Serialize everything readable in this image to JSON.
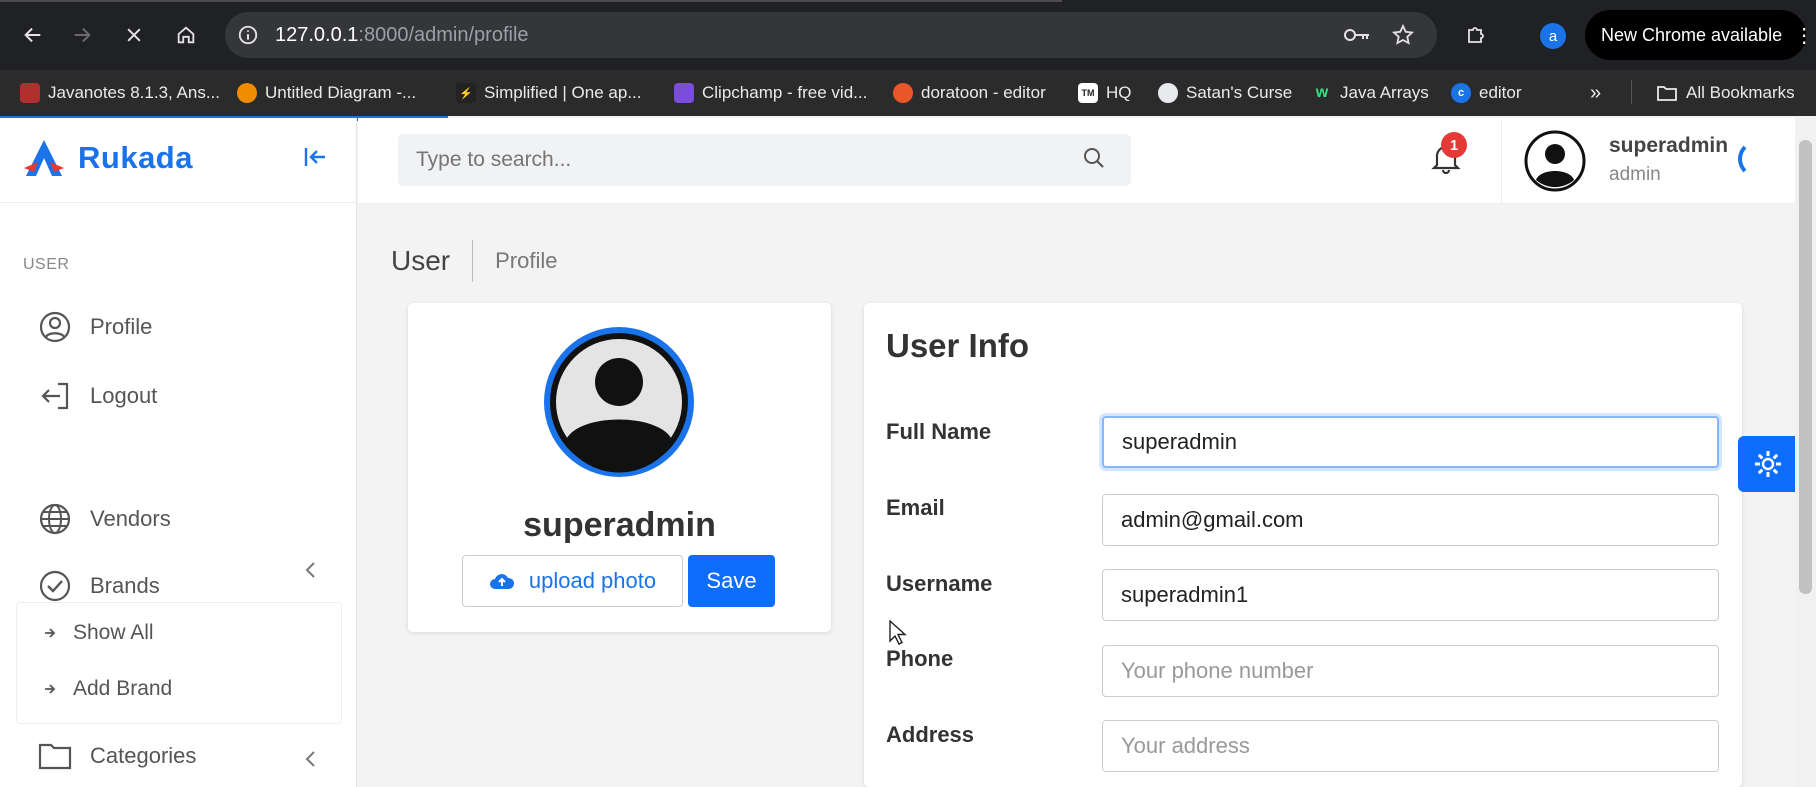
{
  "browser": {
    "url_host": "127.0.0.1",
    "url_rest": ":8000/admin/profile",
    "update_label": "New Chrome available",
    "profile_initial": "a",
    "bookmarks": [
      {
        "label": "Javanotes 8.1.3, Ans...",
        "color": "#b03030"
      },
      {
        "label": "Untitled Diagram -...",
        "color": "#f08c00"
      },
      {
        "label": "Simplified | One ap...",
        "color": "#222222"
      },
      {
        "label": "Clipchamp - free vid...",
        "color": "#7b4ddb"
      },
      {
        "label": "doratoon - editor",
        "color": "#e8562a"
      },
      {
        "label": "HQ",
        "color": "#444444"
      },
      {
        "label": "Satan's Curse",
        "color": "#5f6368"
      },
      {
        "label": "Java Arrays",
        "color": "#2e7d32"
      },
      {
        "label": "editor",
        "color": "#1a73e8"
      }
    ],
    "all_bookmarks": "All Bookmarks"
  },
  "app": {
    "brand": "Rukada",
    "accent": "#1a73e8",
    "search_placeholder": "Type to search...",
    "notifications": "1",
    "user_name": "superadmin",
    "user_role": "admin"
  },
  "sidebar": {
    "section": "USER",
    "items": [
      {
        "label": "Profile",
        "icon": "user-circle-icon"
      },
      {
        "label": "Logout",
        "icon": "logout-icon"
      },
      {
        "label": "Vendors",
        "icon": "globe-icon"
      },
      {
        "label": "Brands",
        "icon": "check-circle-icon"
      },
      {
        "label": "Categories",
        "icon": "folder-icon"
      }
    ],
    "brand_sub": [
      "Show All",
      "Add Brand"
    ]
  },
  "breadcrumb": {
    "root": "User",
    "current": "Profile"
  },
  "profile_card": {
    "name": "superadmin",
    "upload_label": "upload photo",
    "save_label": "Save"
  },
  "user_info": {
    "title": "User Info",
    "fields": [
      {
        "label": "Full Name",
        "value": "superadmin",
        "placeholder": ""
      },
      {
        "label": "Email",
        "value": "admin@gmail.com",
        "placeholder": ""
      },
      {
        "label": "Username",
        "value": "superadmin1",
        "placeholder": ""
      },
      {
        "label": "Phone",
        "value": "",
        "placeholder": "Your phone number"
      },
      {
        "label": "Address",
        "value": "",
        "placeholder": "Your address"
      }
    ]
  }
}
